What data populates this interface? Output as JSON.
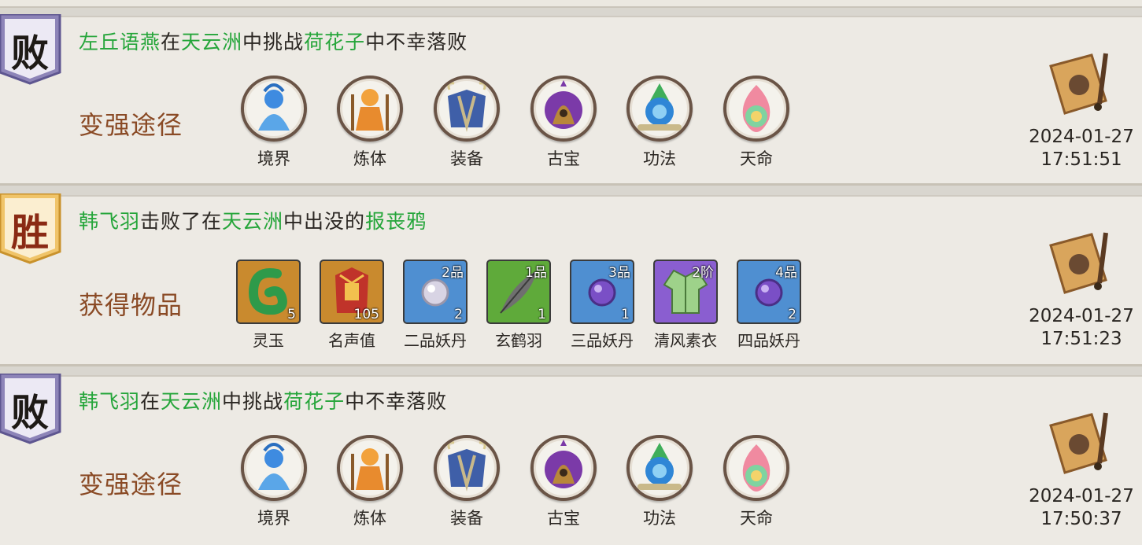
{
  "records": [
    {
      "result": "败",
      "player": "左丘语燕",
      "text_in": "在",
      "location": "天云洲",
      "text_mid": "中挑战",
      "target": "荷花子",
      "text_end": "中不幸落败",
      "section_label": "变强途径",
      "paths": [
        {
          "label": "境界",
          "icon": "realm-icon"
        },
        {
          "label": "炼体",
          "icon": "body-refining-icon"
        },
        {
          "label": "装备",
          "icon": "equipment-icon"
        },
        {
          "label": "古宝",
          "icon": "ancient-treasure-icon"
        },
        {
          "label": "功法",
          "icon": "technique-icon"
        },
        {
          "label": "天命",
          "icon": "destiny-icon"
        }
      ],
      "date": "2024-01-27",
      "time": "17:51:51"
    },
    {
      "result": "胜",
      "player": "韩飞羽",
      "text_mid": "击败了在",
      "location": "天云洲",
      "text_mid2": "中出没的",
      "target": "报丧鸦",
      "section_label": "获得物品",
      "items": [
        {
          "label": "灵玉",
          "qty": "5",
          "grade": "",
          "color": "#c98a2e"
        },
        {
          "label": "名声值",
          "qty": "105",
          "grade": "",
          "color": "#c98a2e"
        },
        {
          "label": "二品妖丹",
          "qty": "2",
          "grade": "2品",
          "color": "#4f8fd1"
        },
        {
          "label": "玄鹤羽",
          "qty": "1",
          "grade": "1品",
          "color": "#5faa3a"
        },
        {
          "label": "三品妖丹",
          "qty": "1",
          "grade": "3品",
          "color": "#4f8fd1"
        },
        {
          "label": "清风素衣",
          "qty": "",
          "grade": "2阶",
          "color": "#8a5ed0"
        },
        {
          "label": "四品妖丹",
          "qty": "2",
          "grade": "4品",
          "color": "#4f8fd1"
        }
      ],
      "date": "2024-01-27",
      "time": "17:51:23"
    },
    {
      "result": "败",
      "player": "韩飞羽",
      "text_in": "在",
      "location": "天云洲",
      "text_mid": "中挑战",
      "target": "荷花子",
      "text_end": "中不幸落败",
      "section_label": "变强途径",
      "paths": [
        {
          "label": "境界",
          "icon": "realm-icon"
        },
        {
          "label": "炼体",
          "icon": "body-refining-icon"
        },
        {
          "label": "装备",
          "icon": "equipment-icon"
        },
        {
          "label": "古宝",
          "icon": "ancient-treasure-icon"
        },
        {
          "label": "功法",
          "icon": "technique-icon"
        },
        {
          "label": "天命",
          "icon": "destiny-icon"
        }
      ],
      "date": "2024-01-27",
      "time": "17:50:37"
    }
  ]
}
